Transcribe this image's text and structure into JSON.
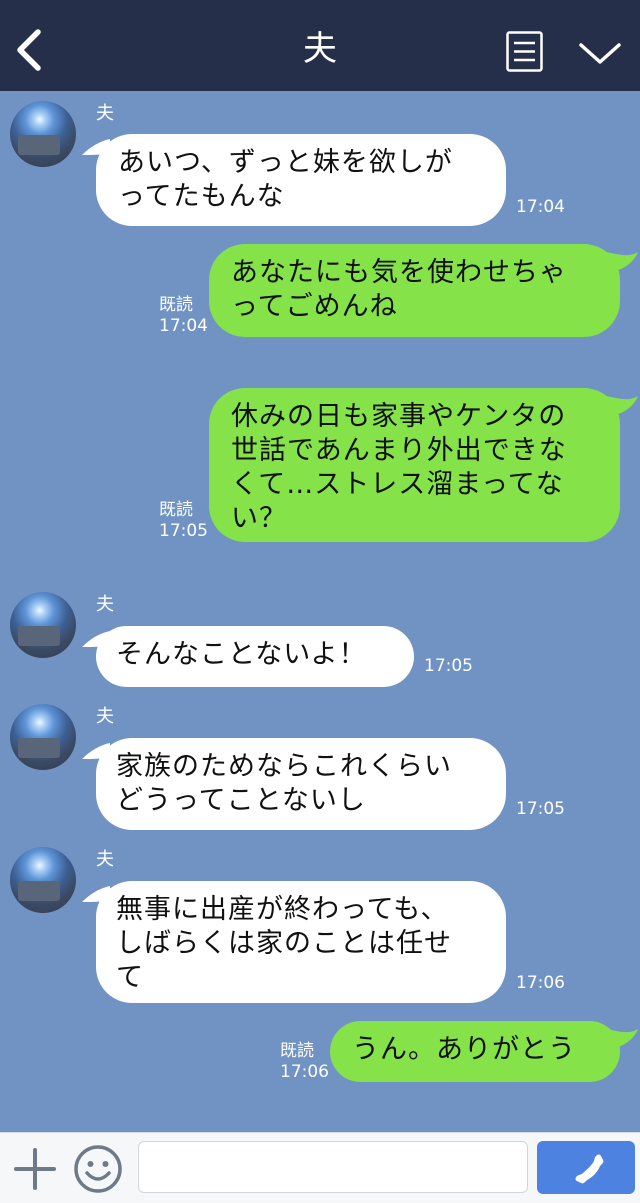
{
  "header": {
    "title": "夫",
    "icons": [
      "back-chevron-icon",
      "menu-list-icon",
      "chevron-down-icon"
    ],
    "background": "#252f49"
  },
  "chat_background": "#7193c3",
  "messages": [
    {
      "sender": "夫",
      "text": "あいつ、ずっと妹を欲しが\nってたもんな",
      "time": "17:04"
    },
    {
      "text": "あなたにも気を使わせちゃ\nってごめんね",
      "status": "既読",
      "time": "17:04"
    },
    {
      "text": "休みの日も家事やケンタの\n世話であんまり外出できな\nくて…ストレス溜まってな\nい？",
      "status": "既読",
      "time": "17:05"
    },
    {
      "sender": "夫",
      "text": "そんなことないよ！",
      "time": "17:05"
    },
    {
      "sender": "夫",
      "text": "家族のためならこれくらい\nどうってことないし",
      "time": "17:05"
    },
    {
      "sender": "夫",
      "text": "無事に出産が終わっても、\nしばらくは家のことは任せ\nて",
      "time": "17:06"
    },
    {
      "text": "うん。ありがとう",
      "status": "既読",
      "time": "17:06"
    }
  ],
  "colors": {
    "incoming_bubble": "#ffffff",
    "outgoing_bubble": "#85e249",
    "send_button": "#4e82e0"
  },
  "input_bar": {
    "icons": [
      "plus-icon",
      "smiley-icon",
      "phone-icon"
    ],
    "placeholder": ""
  }
}
